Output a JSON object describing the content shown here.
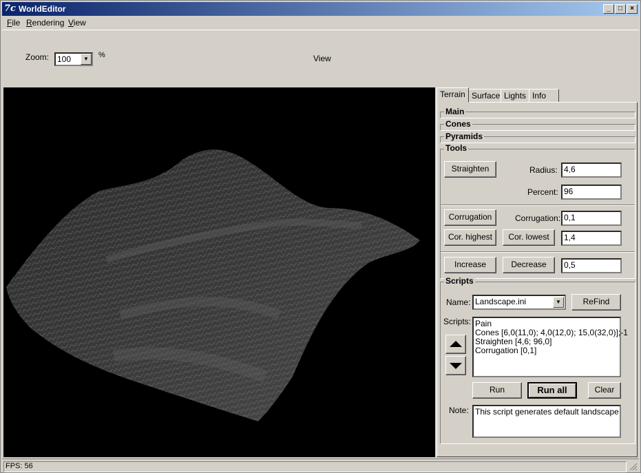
{
  "window": {
    "title": "WorldEditor",
    "app_icon": "7c",
    "minimize_glyph": "_",
    "maximize_glyph": "□",
    "close_glyph": "×"
  },
  "menu": {
    "items": [
      {
        "label": "File",
        "accel": "F",
        "rest": "ile"
      },
      {
        "label": "Rendering",
        "accel": "R",
        "rest": "endering"
      },
      {
        "label": "View",
        "accel": "V",
        "rest": "iew"
      }
    ]
  },
  "toolbar": {
    "zoom_label": "Zoom:",
    "zoom_value": "100",
    "zoom_unit": "%",
    "view_label": "View"
  },
  "tabs": [
    {
      "label": "Terrain",
      "active": true
    },
    {
      "label": "Surface",
      "active": false
    },
    {
      "label": "Lights",
      "active": false
    },
    {
      "label": "Info",
      "active": false
    }
  ],
  "sections": {
    "main": "Main",
    "cones": "Cones",
    "pyramids": "Pyramids",
    "tools": "Tools",
    "scripts": "Scripts"
  },
  "tools": {
    "straighten_btn": "Straighten",
    "radius_label": "Radius:",
    "radius_value": "4,6",
    "percent_label": "Percent:",
    "percent_value": "96",
    "corrugation_btn": "Corrugation",
    "corrugation_label": "Corrugation:",
    "corrugation_value": "0,1",
    "cor_highest_btn": "Cor. highest",
    "cor_lowest_btn": "Cor. lowest",
    "cor_level_value": "1,4",
    "increase_btn": "Increase",
    "decrease_btn": "Decrease",
    "step_value": "0,5"
  },
  "scripts": {
    "name_label": "Name:",
    "name_value": "Landscape.ini",
    "refind_btn": "ReFind",
    "scripts_label": "Scripts:",
    "lines": [
      "Pain",
      "Cones [6,0(11,0); 4,0(12,0); 15,0(32,0)];-1",
      "Straighten [4,6; 96,0]",
      "Corrugation [0,1]"
    ],
    "up_icon": "up-arrow-icon",
    "down_icon": "down-arrow-icon",
    "run_btn": "Run",
    "run_all_btn": "Run all",
    "clear_btn": "Clear",
    "note_label": "Note:",
    "note_value": "This script generates default landscape"
  },
  "status": {
    "text": "FPS: 56"
  },
  "colors": {
    "title_start": "#0a246a",
    "title_end": "#a6caf0",
    "face": "#d4d0c8",
    "viewport_bg": "#000000"
  }
}
